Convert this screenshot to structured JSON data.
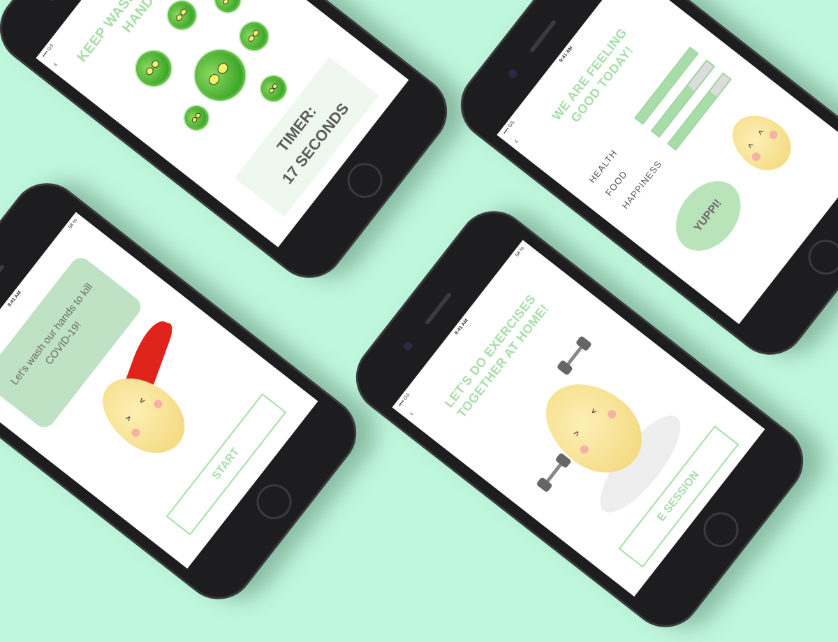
{
  "status_bar": {
    "time": "9:41 AM",
    "signal": "•••• GS",
    "battery": "58 %"
  },
  "screens": {
    "wash": {
      "title": "KEEP WASHING YOUR HANDS!",
      "timer_label": "TIMER:",
      "timer_value": "17 SECONDS"
    },
    "feeling": {
      "title": "WE ARE FEELING GOOD TODAY!",
      "stats": [
        {
          "label": "HEALTH",
          "level": 1.0
        },
        {
          "label": "FOOD",
          "level": 0.65
        },
        {
          "label": "HAPPINESS",
          "level": 0.75
        }
      ],
      "bubble_text": "YUPPI!"
    },
    "intro": {
      "speech": "Let's wash our hands to kill COVID-19!",
      "button": "START"
    },
    "exercise": {
      "title": "LET'S DO EXERCISES TOGETHER AT HOME!",
      "button": "E SESSION"
    }
  },
  "colors": {
    "background": "#bff7dd",
    "accent": "#a6dea7",
    "virus": "#4fb231",
    "bean": "#f6e29a",
    "cape": "#e0241c"
  }
}
